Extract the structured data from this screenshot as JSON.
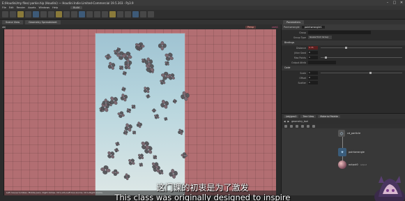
{
  "window": {
    "title": "E:/Houdini/my files/ parkie.hip (Houdini) — Houdini Indie Limited-Commercial 19.5.303 - Py3.9",
    "buttons": [
      "–",
      "□",
      "✕"
    ]
  },
  "menubar": {
    "items": [
      "File",
      "Edit",
      "Render",
      "Assets",
      "Windows",
      "Help"
    ],
    "desktop": "Build"
  },
  "tabs": [
    "Scene View",
    "Geometry Spreadsheet"
  ],
  "viewport": {
    "path_label": "obj",
    "camera_label": "Persp",
    "cam_indicator": "cam1",
    "status": "Left mouse tumbles. Middle pans. Right dollies. Ctrl+Alt+Left box-zooms. Ctrl+Right zooms.",
    "background_colors": {
      "outer": "#b26e72",
      "frame_top": "#9fc3d2",
      "frame_bottom": "#dde7e6"
    }
  },
  "params": {
    "header": "Parameters",
    "node_type": "Pointwrangle",
    "node_name": "pointwrangle1",
    "rows": [
      {
        "label": "Group",
        "value": ""
      },
      {
        "label": "Group Type",
        "value": "Guess from Group"
      },
      {
        "label": "Distance",
        "value": "0.35"
      },
      {
        "label": "Jitter Seed",
        "value": "0"
      },
      {
        "label": "Max Points",
        "value": "1"
      },
      {
        "label": "Output Attrib",
        "value": ""
      }
    ],
    "sections": [
      "Bindings",
      "Code"
    ],
    "rows2": [
      {
        "label": "Scale",
        "value": "1"
      },
      {
        "label": "Offset",
        "value": "0"
      },
      {
        "label": "Scatter",
        "value": "1"
      }
    ]
  },
  "network": {
    "tabs": [
      "/obj/geo1",
      "Tree View",
      "Material Palette"
    ],
    "path": "geometry_tool",
    "nodes": [
      {
        "name": "cd_particle",
        "sub": ""
      },
      {
        "name": "pointwrangle",
        "sub": "geo"
      },
      {
        "name": "output0",
        "sub": "output"
      }
    ]
  },
  "subtitles": {
    "zh": "这门课的初衷是为了激发",
    "en": "This class was originally designed to inspire"
  }
}
